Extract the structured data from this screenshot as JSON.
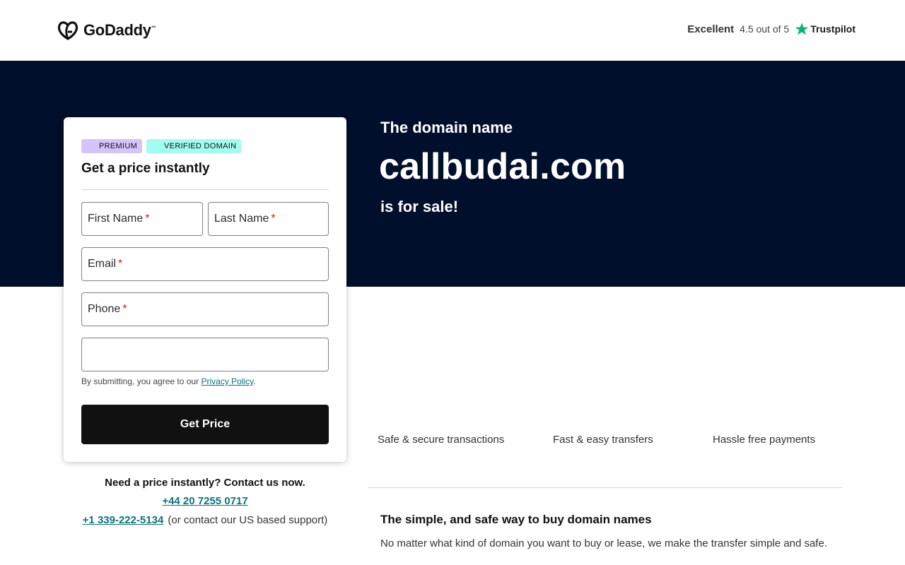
{
  "header": {
    "logo_text": "GoDaddy",
    "logo_tm": "™",
    "trust": {
      "rating_word": "Excellent",
      "score": "4.5 out of 5",
      "brand": "Trustpilot",
      "star_color": "#00b67a"
    }
  },
  "hero": {
    "pre": "The domain name",
    "domain": "callbudai.com",
    "post": "is for sale!",
    "background": "#000f2b"
  },
  "form": {
    "badges": [
      "PREMIUM",
      "VERIFIED DOMAIN"
    ],
    "title": "Get a price instantly",
    "fields": {
      "first_name": "First Name",
      "last_name": "Last Name",
      "email": "Email",
      "phone": "Phone",
      "required_mark": "*",
      "extra": ""
    },
    "consent_prefix": "By submitting, you agree to our",
    "consent_link": "Privacy Policy",
    "consent_suffix": ".",
    "submit_label": "Get Price"
  },
  "contact": {
    "heading": "Need a price instantly? Contact us now.",
    "phone_uk": "+44 20 7255 0717",
    "phone_us": "+1 339-222-5134",
    "us_note": "(or contact our US based support)"
  },
  "features": [
    "Safe & secure transactions",
    "Fast & easy transfers",
    "Hassle free payments"
  ],
  "info": {
    "title": "The simple, and safe way to buy domain names",
    "body": "No matter what kind of domain you want to buy or lease, we make the transfer simple and safe."
  }
}
